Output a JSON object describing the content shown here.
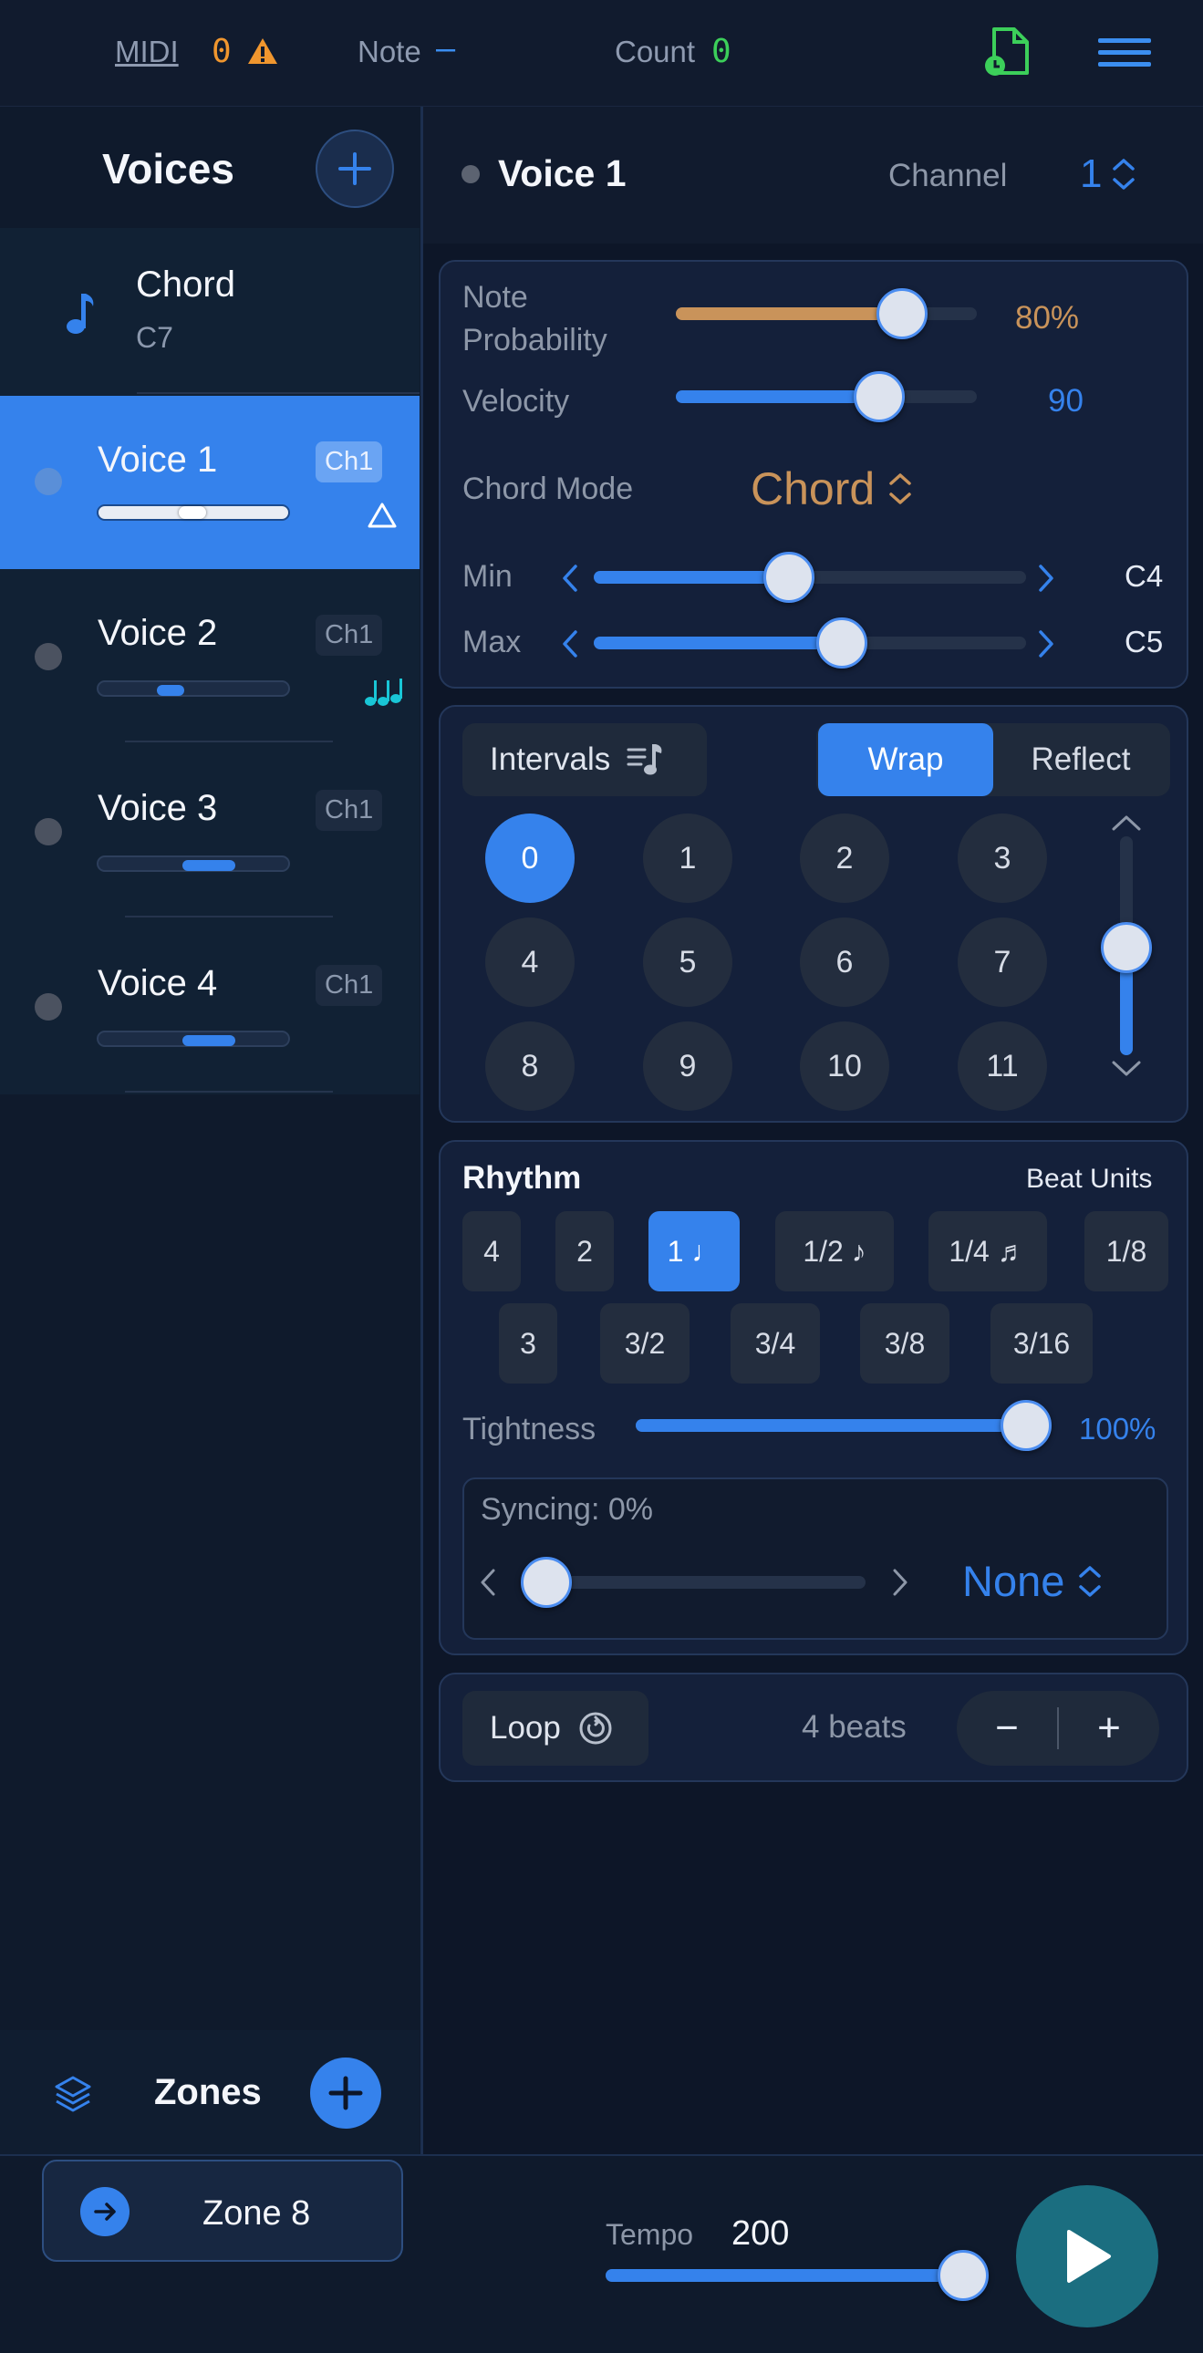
{
  "topbar": {
    "midi_label": "MIDI",
    "midi_count": "0",
    "note_label": "Note",
    "note_value": "–",
    "count_label": "Count",
    "count_value": "0",
    "icons": [
      "warning-icon",
      "midi-file-icon",
      "menu-icon"
    ]
  },
  "sidebar": {
    "title": "Voices",
    "chord_item": {
      "name": "Chord",
      "value": "C7"
    },
    "voices": [
      {
        "name": "Voice 1",
        "channel": "Ch1",
        "level": 0.5,
        "active": true
      },
      {
        "name": "Voice 2",
        "channel": "Ch1",
        "level": 0.35
      },
      {
        "name": "Voice 3",
        "channel": "Ch1",
        "level": 0.6
      },
      {
        "name": "Voice 4",
        "channel": "Ch1",
        "level": 0.6
      }
    ],
    "zones_label": "Zones"
  },
  "header": {
    "voice_name": "Voice 1",
    "channel_label": "Channel",
    "channel_value": "1"
  },
  "params": {
    "note_probability_label": "Note\nProbability",
    "note_probability_value": "80%",
    "velocity_label": "Velocity",
    "velocity_value": "90",
    "chord_mode_label": "Chord Mode",
    "chord_mode_value": "Chord",
    "min_label": "Min",
    "min_value": "C4",
    "max_label": "Max",
    "max_value": "C5"
  },
  "intervals": {
    "label": "Intervals",
    "wrap_label": "Wrap",
    "reflect_label": "Reflect",
    "numbers": [
      "0",
      "1",
      "2",
      "3",
      "4",
      "5",
      "6",
      "7",
      "8",
      "9",
      "10",
      "11"
    ],
    "selected": "0"
  },
  "rhythm": {
    "label": "Rhythm",
    "beat_units_label": "Beat Units",
    "row1": [
      "4",
      "2",
      "1 ♩",
      "1/2 ♪",
      "1/4 ♬",
      "1/8"
    ],
    "row2": [
      "3",
      "3/2",
      "3/4",
      "3/8",
      "3/16"
    ],
    "selected": "1 ♩",
    "tightness_label": "Tightness",
    "tightness_value": "100%",
    "syncing_label": "Syncing: 0%",
    "syncing_mode": "None"
  },
  "loop": {
    "label": "Loop",
    "beats": "4 beats",
    "minus": "−",
    "plus": "+"
  },
  "bottom": {
    "zone_label": "Zone 8",
    "tempo_label": "Tempo",
    "tempo_value": "200"
  },
  "colors": {
    "accent": "#3582ec",
    "orange": "#f0962e",
    "probability": "#c9935a",
    "green": "#3ccf5a",
    "play": "#1b6e80"
  }
}
